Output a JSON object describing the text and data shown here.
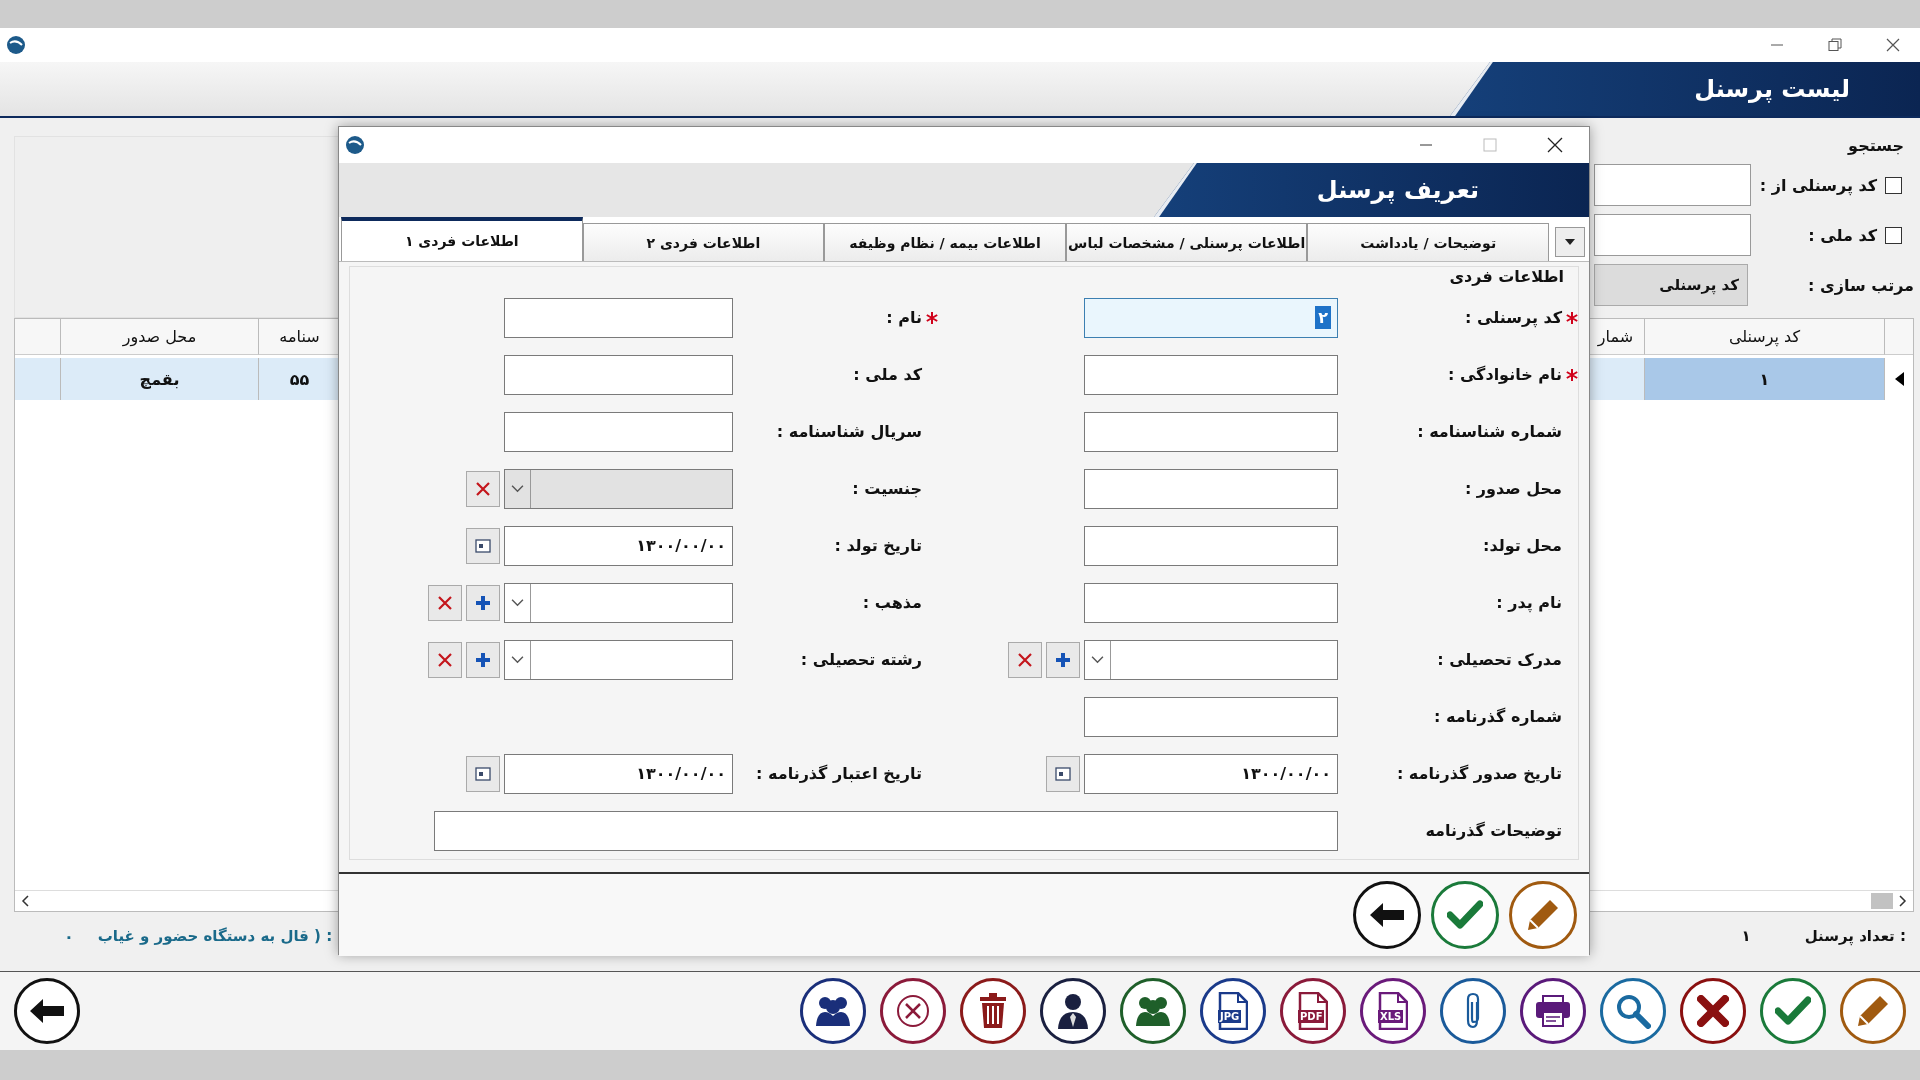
{
  "main": {
    "title": "لیست پرسنل",
    "search": {
      "title": "جستجو",
      "filters": [
        {
          "label": "کد پرسنلی از :",
          "checked": false
        },
        {
          "label": "کد ملی :",
          "checked": false
        }
      ],
      "sort_label": "مرتب سازی :",
      "sort_value": "کد پرسنلی"
    },
    "grid": {
      "right_columns": [
        "کد پرسنلی",
        "شمار"
      ],
      "left_columns": [
        "سنامه",
        "محل صدور"
      ],
      "rows": [
        {
          "personnel_code": "۱",
          "column_2": "۵۵",
          "issue_place": "بقمچ",
          "selected": true
        }
      ]
    },
    "status": {
      "count_label": "تعداد پرسنل :",
      "count_value": "۱",
      "attendance_label": "قال به دستگاه حضور و غیاب ) :",
      "attendance_value": "۰"
    },
    "toolbar": [
      {
        "kind": "edit",
        "color": "#a05a10"
      },
      {
        "kind": "confirm",
        "color": "#1a7a3a"
      },
      {
        "kind": "close",
        "color": "#8a1010"
      },
      {
        "kind": "search",
        "color": "#1a6aa0"
      },
      {
        "kind": "print",
        "color": "#5a1a7a"
      },
      {
        "kind": "attach",
        "color": "#1a5a9a"
      },
      {
        "kind": "file",
        "label": "XLS",
        "color": "#6a1a7a"
      },
      {
        "kind": "file",
        "label": "PDF",
        "color": "#8a1a3a"
      },
      {
        "kind": "file",
        "label": "JPG",
        "color": "#1a3a8a"
      },
      {
        "kind": "group",
        "color": "#1f5f2a"
      },
      {
        "kind": "user",
        "color": "#1a2040"
      },
      {
        "kind": "delete",
        "color": "#8b1a1a"
      },
      {
        "kind": "cancel",
        "color": "#8b1a3a"
      },
      {
        "kind": "users",
        "color": "#1a2f7a"
      }
    ]
  },
  "dialog": {
    "title": "تعریف پرسنل",
    "tabs": [
      {
        "label": "توضیحات / یادداشت",
        "selected": false
      },
      {
        "label": "اطلاعات پرسنلی / مشخصات لباس",
        "selected": false
      },
      {
        "label": "اطلاعات بیمه / نظام وظیفه",
        "selected": false
      },
      {
        "label": "اطلاعات فردی ۲",
        "selected": false
      },
      {
        "label": "اطلاعات فردی ۱",
        "selected": true
      }
    ],
    "group_title": "اطلاعات فردی",
    "rows": [
      {
        "right": {
          "label": "کد پرسنلی :",
          "required": true,
          "kind": "text",
          "value": "۲",
          "focused": true
        },
        "left": {
          "label": "نام :",
          "required": true,
          "kind": "text",
          "focused": false
        }
      },
      {
        "right": {
          "label": "نام خانوادگی :",
          "required": true,
          "kind": "text",
          "focused": false
        },
        "left": {
          "label": "کد ملی :",
          "required": false,
          "kind": "text",
          "focused": false
        }
      },
      {
        "right": {
          "label": "شماره شناسنامه :",
          "required": false,
          "kind": "text",
          "focused": false
        },
        "left": {
          "label": "سریال شناسنامه :",
          "required": false,
          "kind": "text",
          "focused": false
        }
      },
      {
        "right": {
          "label": "محل صدور :",
          "required": false,
          "kind": "text",
          "focused": false
        },
        "left": {
          "label": "جنسیت :",
          "required": false,
          "kind": "combo",
          "disabled": true,
          "buttons": [
            {
              "kind": "clear"
            }
          ],
          "focused": false
        }
      },
      {
        "right": {
          "label": "محل تولد:",
          "required": false,
          "kind": "text",
          "focused": false
        },
        "left": {
          "label": "تاریخ تولد :",
          "required": false,
          "kind": "date",
          "value": "۱۳۰۰/۰۰/۰۰",
          "focused": false
        }
      },
      {
        "right": {
          "label": "نام پدر :",
          "required": false,
          "kind": "text",
          "focused": false
        },
        "left": {
          "label": "مذهب :",
          "required": false,
          "kind": "combo",
          "disabled": false,
          "buttons": [
            {
              "kind": "add"
            },
            {
              "kind": "clear"
            }
          ],
          "focused": false
        }
      },
      {
        "right": {
          "label": "مدرک تحصیلی :",
          "required": false,
          "kind": "combo",
          "disabled": false,
          "buttons": [
            {
              "kind": "add"
            },
            {
              "kind": "clear"
            }
          ],
          "focused": false
        },
        "left": {
          "label": "رشته تحصیلی :",
          "required": false,
          "kind": "combo",
          "disabled": false,
          "buttons": [
            {
              "kind": "add"
            },
            {
              "kind": "clear"
            }
          ],
          "focused": false
        }
      },
      {
        "right": {
          "label": "شماره گذرنامه :",
          "required": false,
          "kind": "text",
          "focused": false
        }
      },
      {
        "right": {
          "label": "تاریخ صدور گذرنامه :",
          "required": false,
          "kind": "date",
          "value": "۱۳۰۰/۰۰/۰۰",
          "focused": false
        },
        "left": {
          "label": "تاریخ اعتبار گذرنامه :",
          "required": false,
          "kind": "date",
          "value": "۱۳۰۰/۰۰/۰۰",
          "focused": false
        }
      },
      {
        "right": {
          "label": "توضیحات گذرنامه",
          "required": false,
          "kind": "wide",
          "focused": false
        }
      }
    ],
    "actions": [
      {
        "kind": "edit"
      },
      {
        "kind": "confirm"
      },
      {
        "kind": "back"
      }
    ]
  }
}
